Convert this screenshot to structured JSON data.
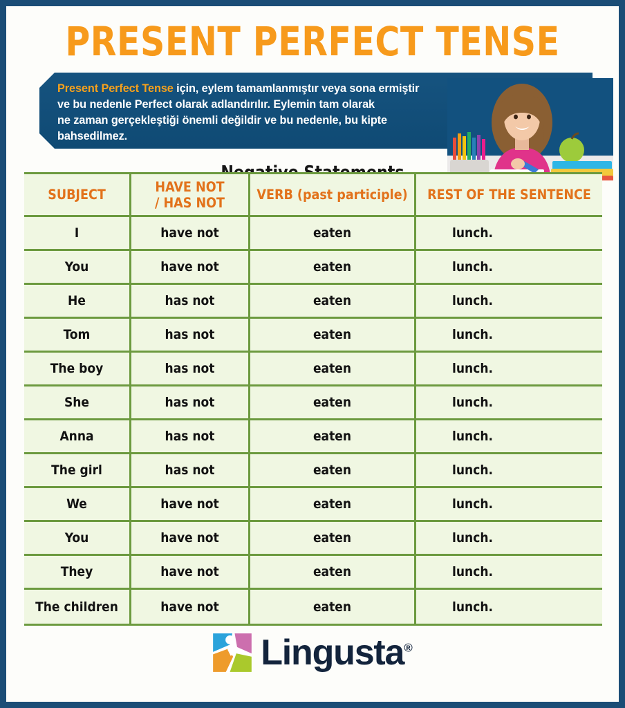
{
  "poster": {
    "title": "PRESENT PERFECT TENSE",
    "accent_orange": "#f79a1b",
    "header_orange": "#e2721b",
    "banner_blue": "#12517f",
    "table_green": "#6c9a3f",
    "table_bg": "#f0f7e2",
    "border_navy": "#1b4d76"
  },
  "banner": {
    "highlight": "Present Perfect Tense",
    "line1_rest": " için, eylem tamamlanmıştır veya sona ermiştir",
    "line2": "ve bu nedenle Perfect olarak adlandırılır. Eylemin tam olarak",
    "line3": "ne zaman gerçekleştiği önemli değildir ve bu nedenle, bu kipte",
    "line4": "bahsedilmez."
  },
  "section": {
    "heading": "Negative Statements"
  },
  "table": {
    "headers": {
      "subject": "SUBJECT",
      "aux_line1": "HAVE NOT",
      "aux_line2": "/ HAS NOT",
      "verb": "VERB (past participle)",
      "rest": "REST OF THE SENTENCE"
    },
    "rows": [
      {
        "subject": "I",
        "aux": "have not",
        "verb": "eaten",
        "rest": "lunch."
      },
      {
        "subject": "You",
        "aux": "have not",
        "verb": "eaten",
        "rest": "lunch."
      },
      {
        "subject": "He",
        "aux": "has not",
        "verb": "eaten",
        "rest": "lunch."
      },
      {
        "subject": "Tom",
        "aux": "has not",
        "verb": "eaten",
        "rest": "lunch."
      },
      {
        "subject": "The boy",
        "aux": "has not",
        "verb": "eaten",
        "rest": "lunch."
      },
      {
        "subject": "She",
        "aux": "has not",
        "verb": "eaten",
        "rest": "lunch."
      },
      {
        "subject": "Anna",
        "aux": "has not",
        "verb": "eaten",
        "rest": "lunch."
      },
      {
        "subject": "The girl",
        "aux": "has not",
        "verb": "eaten",
        "rest": "lunch."
      },
      {
        "subject": "We",
        "aux": "have not",
        "verb": "eaten",
        "rest": "lunch."
      },
      {
        "subject": "You",
        "aux": "have not",
        "verb": "eaten",
        "rest": "lunch."
      },
      {
        "subject": "They",
        "aux": "have not",
        "verb": "eaten",
        "rest": "lunch."
      },
      {
        "subject": "The children",
        "aux": "have not",
        "verb": "eaten",
        "rest": "lunch."
      }
    ]
  },
  "logo": {
    "name": "Lingusta",
    "registered": "®",
    "mark_colors": {
      "blue": "#2ba3db",
      "pink": "#cc6fae",
      "orange": "#ee9b2b",
      "green": "#aac party"
    }
  }
}
